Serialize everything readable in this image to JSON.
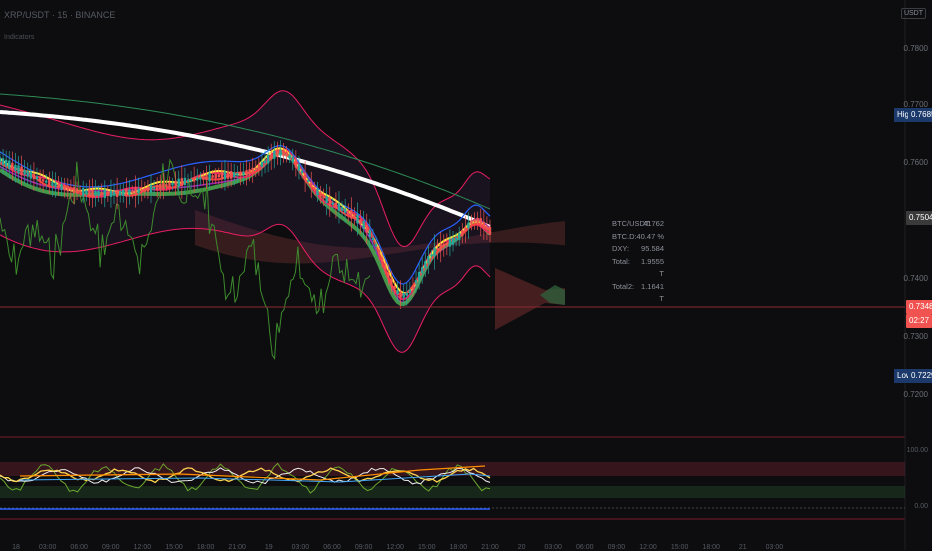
{
  "header": {
    "symbol_line": "XRP/USDT · 15 · BINANCE",
    "sub_line": "Indicators"
  },
  "currency_button": "USDT",
  "price_axis": {
    "ticks": [
      "0.7800",
      "0.7700",
      "0.7600",
      "0.7500",
      "0.7400",
      "0.7300",
      "0.7200"
    ]
  },
  "price_tags": {
    "high_label": "High",
    "high_value": "0.7685",
    "mid_value": "0.7504",
    "current_value": "0.7348",
    "countdown": "02:27",
    "low_label": "Low",
    "low_value": "0.7229"
  },
  "info_panel": [
    {
      "key": "BTC/USDT:",
      "value": "41762"
    },
    {
      "key": "BTC.D:",
      "value": "40.47 %"
    },
    {
      "key": "DXY:",
      "value": "95.584"
    },
    {
      "key": "Total:",
      "value": "1.9555 T"
    },
    {
      "key": "Total2:",
      "value": "1.1641 T"
    }
  ],
  "oscillator_axis": {
    "upper": "100.00",
    "lower": "0.00"
  },
  "time_axis": [
    "18",
    "03:00",
    "06:00",
    "09:00",
    "12:00",
    "15:00",
    "18:00",
    "21:00",
    "19",
    "03:00",
    "06:00",
    "09:00",
    "12:00",
    "15:00",
    "18:00",
    "21:00",
    "20",
    "03:00",
    "06:00",
    "09:00",
    "12:00",
    "15:00",
    "18:00",
    "21",
    "03:00"
  ],
  "colors": {
    "background": "#0d0d0f",
    "bullish": "#26a69a",
    "bearish": "#ef5350",
    "price_line": "#ef5350",
    "current_tag": "#f05350",
    "axis_tag_dark": "#2b2b2b",
    "ma_white": "#ffffff",
    "ma_green": "#4caf50",
    "ma_yellow": "#ffeb3b",
    "ma_red": "#ff3d3d",
    "ma_pink": "#e91e63",
    "ma_purple": "#9c27b0",
    "ma_blue": "#2962ff",
    "cloud": "#5a2a2a"
  }
}
